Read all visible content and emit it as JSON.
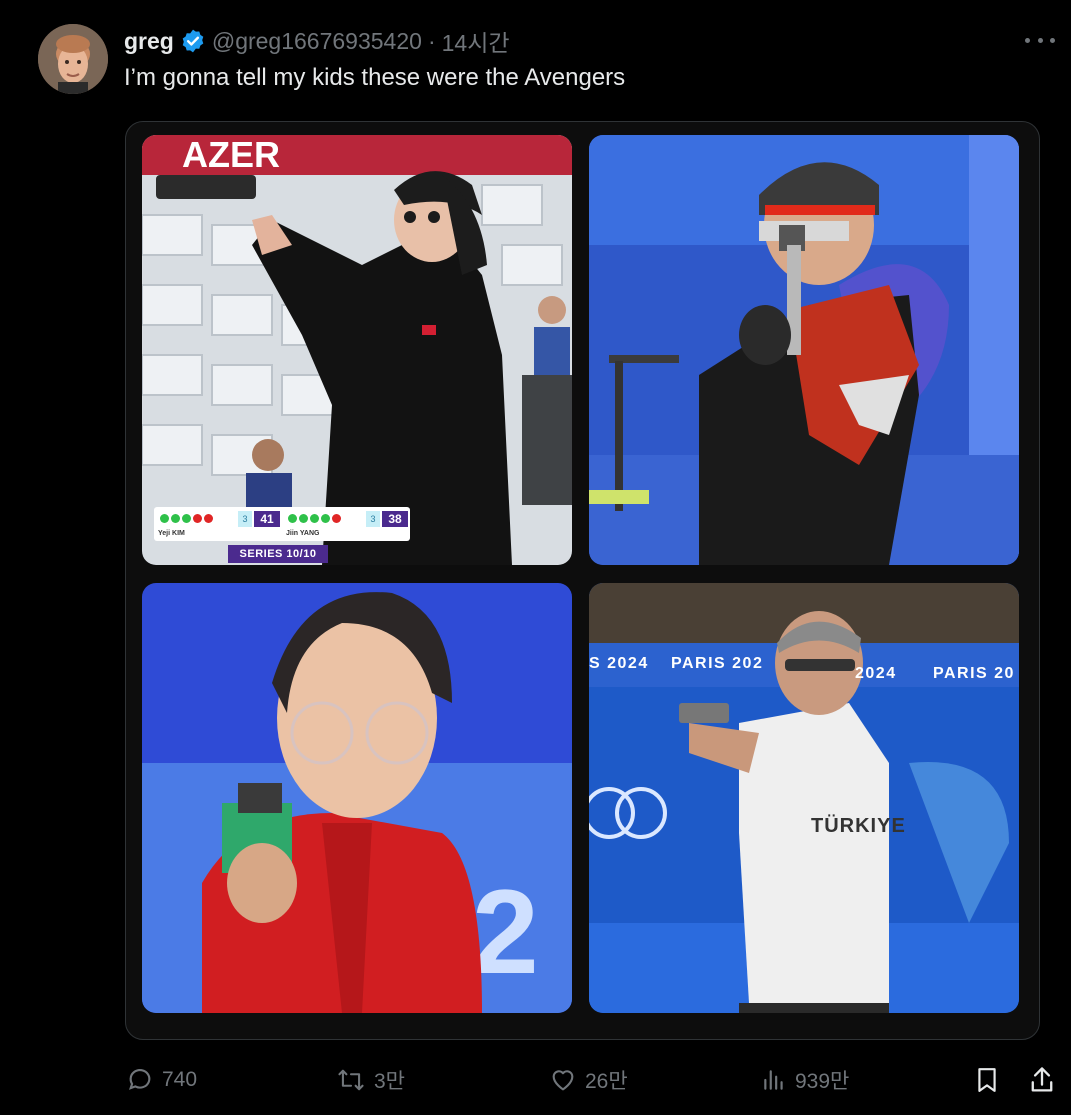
{
  "author": {
    "name": "greg",
    "handle": "@greg16676935420",
    "separator": "·",
    "time": "14시간",
    "verified_color": "#1d9bf0"
  },
  "tweet_text": "I’m gonna tell my kids these were the Avengers",
  "media": {
    "photo1": {
      "scoreboard": {
        "left_score": "41",
        "right_score": "38",
        "left_lane": "3",
        "right_lane": "3",
        "left_name": "Yeji KIM",
        "right_name": "Jiin YANG",
        "series": "SERIES 10/10"
      },
      "banner_text": "AZER"
    },
    "photo4": {
      "paris_a": "S 2024",
      "paris_b": "PARIS 202",
      "paris_c": "2024",
      "paris_d": "PARIS 20",
      "shirt": "TÜRKIYE"
    }
  },
  "actions": {
    "replies": "740",
    "retweets": "3만",
    "likes": "26만",
    "views": "939만"
  },
  "icons": {
    "more": "more-dots-icon",
    "reply": "reply-icon",
    "retweet": "retweet-icon",
    "like": "heart-icon",
    "views": "views-icon",
    "bookmark": "bookmark-icon",
    "share": "share-icon"
  },
  "colors": {
    "background": "#000000",
    "text": "#e7e9ea",
    "muted": "#71767b",
    "border": "#2f3336",
    "accent": "#1d9bf0"
  }
}
